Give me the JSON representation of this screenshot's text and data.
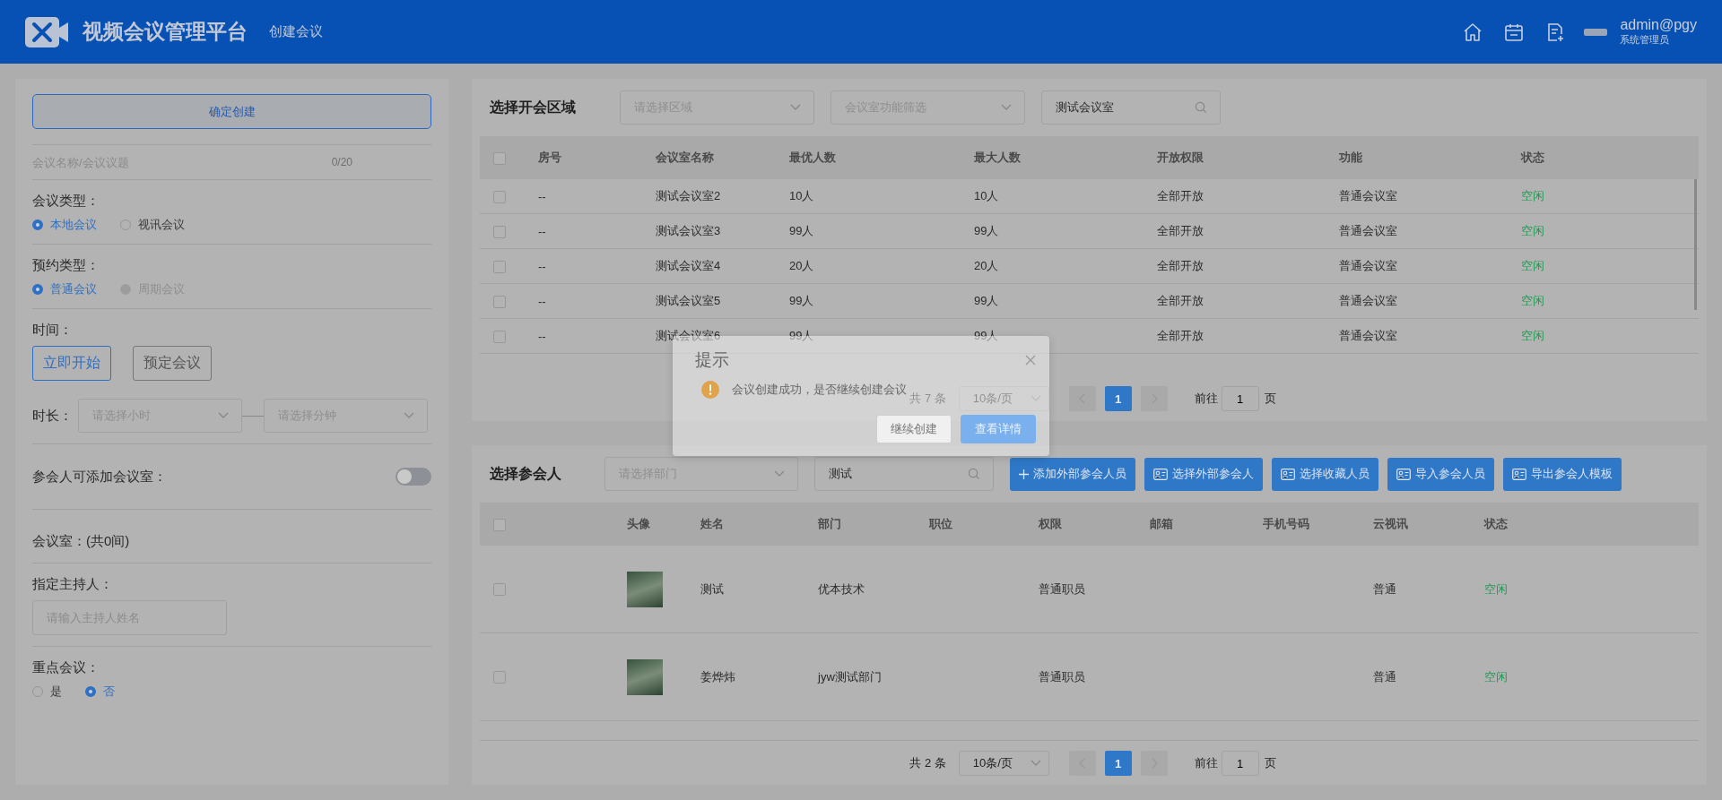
{
  "header": {
    "title": "视频会议管理平台",
    "subtitle": "创建会议",
    "user": "admin@pgy",
    "role": "系统管理员"
  },
  "left": {
    "confirm_button": "确定创建",
    "name_field": {
      "placeholder": "会议名称/会议议题",
      "counter": "0/20"
    },
    "meeting_type": {
      "label": "会议类型：",
      "options": [
        {
          "label": "本地会议",
          "selected": true
        },
        {
          "label": "视讯会议",
          "selected": false
        }
      ]
    },
    "booking_type": {
      "label": "预约类型：",
      "options": [
        {
          "label": "普通会议",
          "selected": true,
          "disabled": false
        },
        {
          "label": "周期会议",
          "selected": false,
          "disabled": true
        }
      ]
    },
    "time": {
      "label": "时间：",
      "buttons": [
        {
          "label": "立即开始",
          "selected": true
        },
        {
          "label": "预定会议",
          "selected": false
        }
      ]
    },
    "duration": {
      "label": "时长：",
      "hour_placeholder": "请选择小时",
      "minute_placeholder": "请选择分钟"
    },
    "allow_add_room": {
      "label": "参会人可添加会议室：",
      "on": false
    },
    "rooms_label": "会议室：(共0间)",
    "host": {
      "label": "指定主持人：",
      "placeholder": "请输入主持人姓名"
    },
    "key_meeting": {
      "label": "重点会议：",
      "options": [
        {
          "label": "是",
          "selected": false
        },
        {
          "label": "否",
          "selected": true
        }
      ]
    }
  },
  "rooms": {
    "title": "选择开会区域",
    "region_placeholder": "请选择区域",
    "function_placeholder": "会议室功能筛选",
    "search_value": "测试会议室",
    "select_all_checked": false,
    "columns": [
      "房号",
      "会议室名称",
      "最优人数",
      "最大人数",
      "开放权限",
      "功能",
      "状态"
    ],
    "rows": [
      {
        "checked": false,
        "cells": [
          "--",
          "测试会议室2",
          "10人",
          "10人",
          "全部开放",
          "普通会议室",
          "空闲"
        ]
      },
      {
        "checked": false,
        "cells": [
          "--",
          "测试会议室3",
          "99人",
          "99人",
          "全部开放",
          "普通会议室",
          "空闲"
        ]
      },
      {
        "checked": false,
        "cells": [
          "--",
          "测试会议室4",
          "20人",
          "20人",
          "全部开放",
          "普通会议室",
          "空闲"
        ]
      },
      {
        "checked": false,
        "cells": [
          "--",
          "测试会议室5",
          "99人",
          "99人",
          "全部开放",
          "普通会议室",
          "空闲"
        ]
      },
      {
        "checked": false,
        "cells": [
          "--",
          "测试会议室6",
          "99人",
          "99人",
          "全部开放",
          "普通会议室",
          "空闲"
        ]
      }
    ],
    "pagination": {
      "total": "共 7 条",
      "page_size": "10条/页",
      "pages": [
        {
          "label": "1",
          "selected": true
        }
      ],
      "goto": "前往",
      "goto_value": "1",
      "page_unit": "页"
    }
  },
  "participants": {
    "title": "选择参会人",
    "department_placeholder": "请选择部门",
    "search_value": "测试",
    "buttons": [
      {
        "label": "添加外部参会人员",
        "kind": "plus"
      },
      {
        "label": "选择外部参会人",
        "kind": "card"
      },
      {
        "label": "选择收藏人员",
        "kind": "card"
      },
      {
        "label": "导入参会人员",
        "kind": "card"
      },
      {
        "label": "导出参会人模板",
        "kind": "card"
      }
    ],
    "select_all_checked": false,
    "columns": [
      "头像",
      "姓名",
      "部门",
      "职位",
      "权限",
      "邮箱",
      "手机号码",
      "云视讯",
      "状态"
    ],
    "rows": [
      {
        "checked": false,
        "name": "测试",
        "department": "优本技术",
        "permission": "普通职员",
        "cloud_video": "普通",
        "status": "空闲"
      },
      {
        "checked": false,
        "name": "姜烨炜",
        "department": "jyw测试部门",
        "permission": "普通职员",
        "cloud_video": "普通",
        "status": "空闲"
      }
    ],
    "pagination": {
      "total": "共 2 条",
      "page_size": "10条/页",
      "pages": [
        {
          "label": "1",
          "selected": true
        }
      ],
      "goto": "前往",
      "goto_value": "1",
      "page_unit": "页"
    }
  },
  "dialog": {
    "title": "提示",
    "message": "会议创建成功，是否继续创建会议",
    "buttons": [
      {
        "label": "继续创建",
        "kind": "default"
      },
      {
        "label": "查看详情",
        "kind": "primary"
      }
    ]
  }
}
